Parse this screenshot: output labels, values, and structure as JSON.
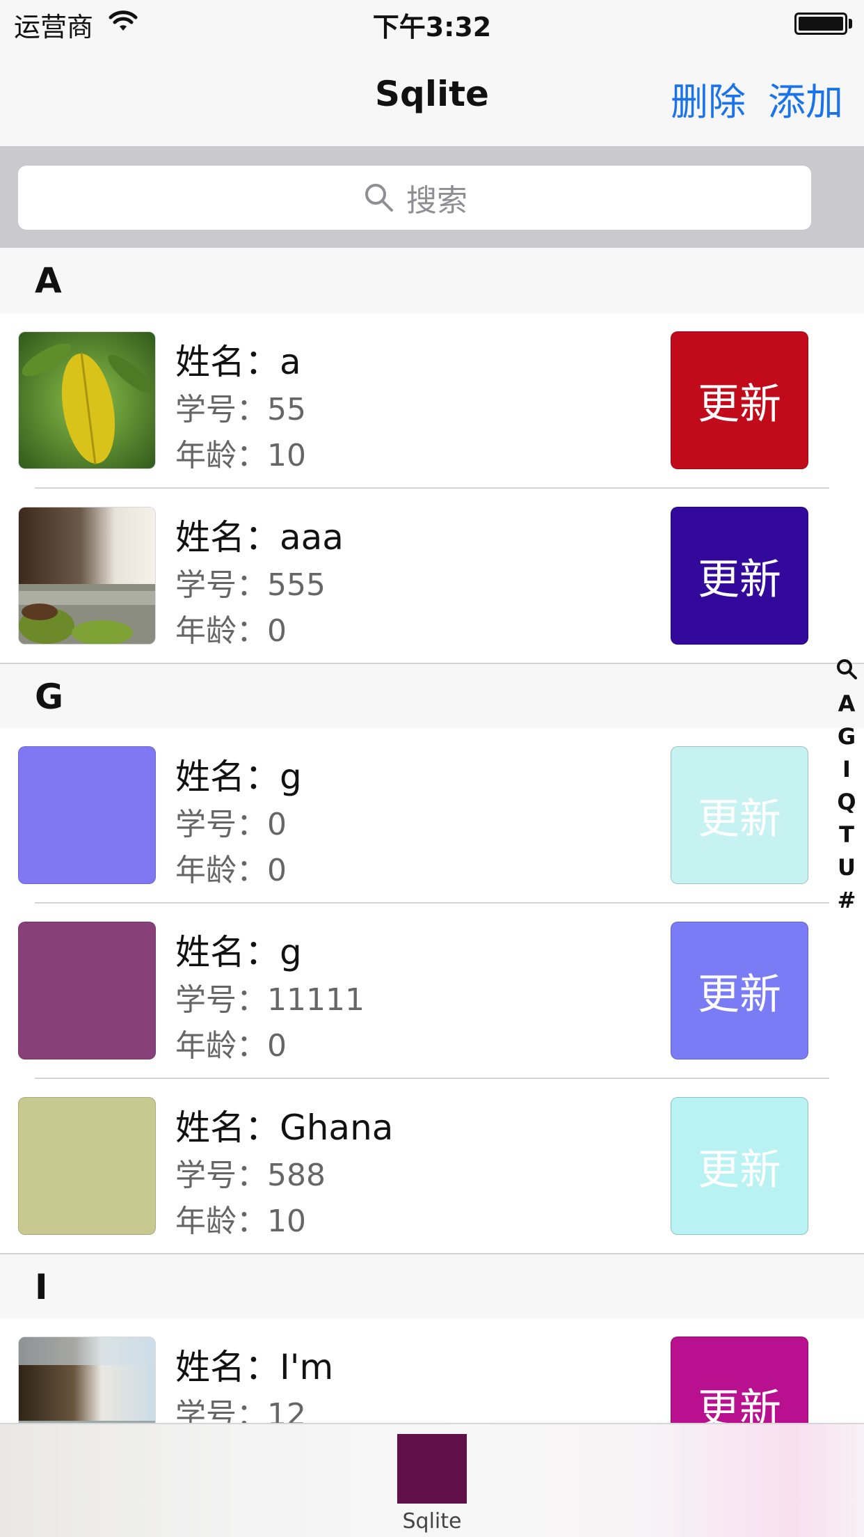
{
  "status_bar": {
    "carrier": "运营商",
    "time": "下午3:32"
  },
  "nav": {
    "title": "Sqlite",
    "delete_label": "删除",
    "add_label": "添加",
    "accent_color": "#1a73e8"
  },
  "search": {
    "placeholder": "搜索"
  },
  "labels": {
    "name": "姓名：",
    "id": "学号：",
    "age": "年龄："
  },
  "sections": [
    {
      "letter": "A",
      "rows": [
        {
          "name": "a",
          "id": "55",
          "age": "10",
          "thumb": "photo-leaf",
          "button_label": "更新",
          "button_color": "#c10b1b"
        },
        {
          "name": "aaa",
          "id": "555",
          "age": "0",
          "thumb": "photo-waterfall",
          "button_label": "更新",
          "button_color": "#33099b"
        }
      ]
    },
    {
      "letter": "G",
      "rows": [
        {
          "name": "g",
          "id": "0",
          "age": "0",
          "thumb_color": "#8077f2",
          "button_label": "更新",
          "button_color": "#c7f2f2"
        },
        {
          "name": "g",
          "id": "11111",
          "age": "0",
          "thumb_color": "#884079",
          "button_label": "更新",
          "button_color": "#7a7cf5"
        },
        {
          "name": "Ghana",
          "id": "588",
          "age": "10",
          "thumb_color": "#c7c990",
          "button_label": "更新",
          "button_color": "#b8f2f2"
        }
      ]
    },
    {
      "letter": "I",
      "rows": [
        {
          "name": "I'm",
          "id": "12",
          "age": "",
          "thumb": "photo-waterfall-2",
          "button_label": "更新",
          "button_color": "#b8108e"
        }
      ]
    }
  ],
  "index_bar": [
    "A",
    "G",
    "I",
    "Q",
    "T",
    "U",
    "#"
  ],
  "tab_bar": {
    "label": "Sqlite",
    "icon_color": "#611049"
  }
}
